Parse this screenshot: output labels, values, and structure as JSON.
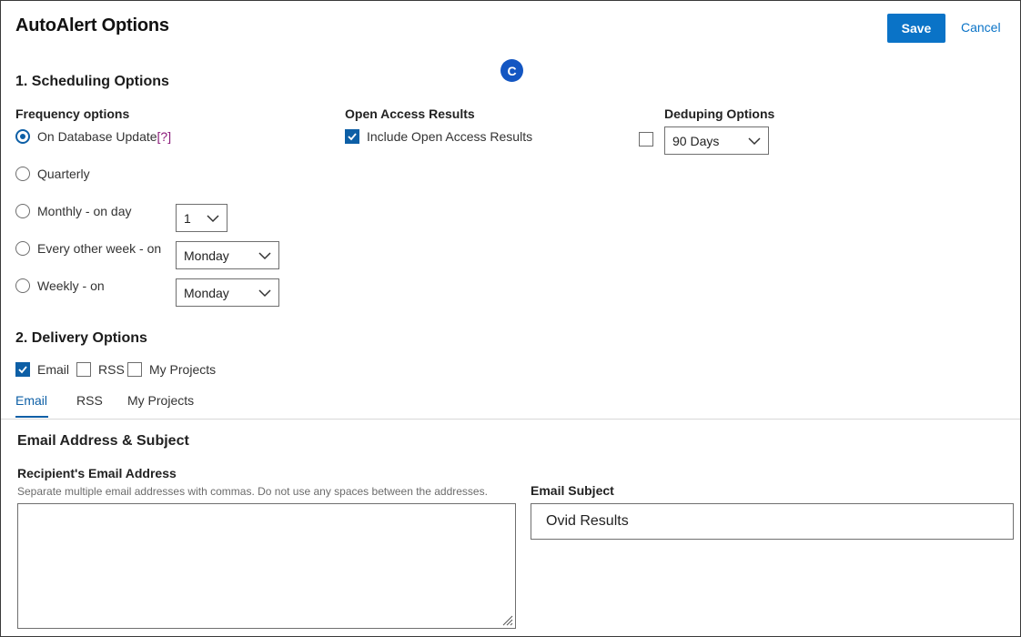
{
  "header": {
    "title": "AutoAlert Options",
    "save_label": "Save",
    "cancel_label": "Cancel"
  },
  "badge": {
    "letter": "C",
    "color": "#1356c2"
  },
  "scheduling": {
    "section_title": "1. Scheduling Options",
    "frequency_label": "Frequency options",
    "options": [
      {
        "label": "On Database Update",
        "checked": true,
        "help": "[?]"
      },
      {
        "label": "Quarterly",
        "checked": false
      },
      {
        "label": "Monthly - on day",
        "checked": false,
        "select_value": "1"
      },
      {
        "label": "Every other week - on",
        "checked": false,
        "select_value": "Monday"
      },
      {
        "label": "Weekly - on",
        "checked": false,
        "select_value": "Monday"
      }
    ],
    "open_access": {
      "label": "Open Access Results",
      "checkbox_label": "Include Open Access Results",
      "checked": true
    },
    "deduping": {
      "label": "Deduping Options",
      "checked": false,
      "select_value": "90 Days"
    }
  },
  "delivery": {
    "section_title": "2. Delivery Options",
    "checkboxes": [
      {
        "label": "Email",
        "checked": true
      },
      {
        "label": "RSS",
        "checked": false
      },
      {
        "label": "My Projects",
        "checked": false
      }
    ],
    "tabs": [
      {
        "label": "Email",
        "active": true
      },
      {
        "label": "RSS",
        "active": false
      },
      {
        "label": "My Projects",
        "active": false
      }
    ]
  },
  "email_panel": {
    "title": "Email Address & Subject",
    "recipient_label": "Recipient's Email Address",
    "recipient_hint": "Separate multiple email addresses with commas. Do not use any spaces between the addresses.",
    "recipient_value": "",
    "subject_label": "Email Subject",
    "subject_value": "Ovid Results"
  },
  "colors": {
    "accent": "#0a73c7",
    "control_blue": "#0d5fa6",
    "help_link": "#8b1a7a"
  },
  "icons": {
    "dropdown": "chevron-down-icon",
    "check": "checkmark-icon",
    "resize": "resize-handle-icon"
  }
}
